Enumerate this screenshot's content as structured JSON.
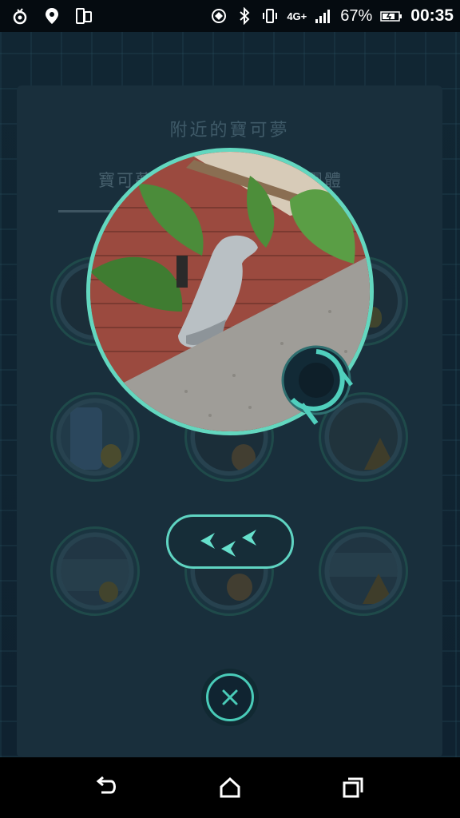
{
  "status_bar": {
    "battery_percent": "67%",
    "time": "00:35",
    "network_label": "4G+"
  },
  "panel": {
    "title": "附近的寶可夢",
    "tabs": [
      {
        "label": "寶可夢"
      },
      {
        "label": "團體"
      }
    ]
  },
  "colors": {
    "accent": "#63d7bf",
    "panel_bg": "#192f3c",
    "status_bar_bg": "#050b10"
  },
  "icons": {
    "scan": "pokestop-scan-icon",
    "footprints": "footprints-icon",
    "close": "close-icon"
  },
  "footprints": {
    "count": 3
  }
}
